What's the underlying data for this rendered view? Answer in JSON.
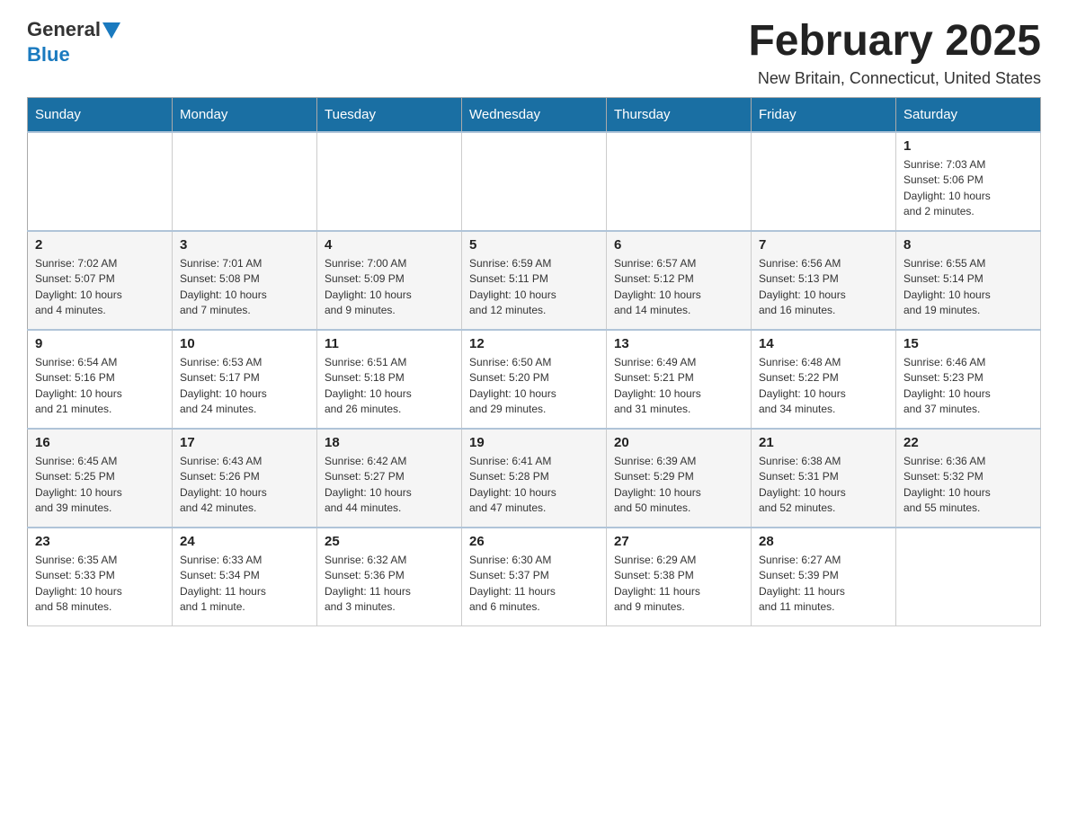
{
  "header": {
    "logo_general": "General",
    "logo_blue": "Blue",
    "title": "February 2025",
    "subtitle": "New Britain, Connecticut, United States"
  },
  "days_of_week": [
    "Sunday",
    "Monday",
    "Tuesday",
    "Wednesday",
    "Thursday",
    "Friday",
    "Saturday"
  ],
  "weeks": [
    [
      {
        "day": "",
        "info": ""
      },
      {
        "day": "",
        "info": ""
      },
      {
        "day": "",
        "info": ""
      },
      {
        "day": "",
        "info": ""
      },
      {
        "day": "",
        "info": ""
      },
      {
        "day": "",
        "info": ""
      },
      {
        "day": "1",
        "info": "Sunrise: 7:03 AM\nSunset: 5:06 PM\nDaylight: 10 hours\nand 2 minutes."
      }
    ],
    [
      {
        "day": "2",
        "info": "Sunrise: 7:02 AM\nSunset: 5:07 PM\nDaylight: 10 hours\nand 4 minutes."
      },
      {
        "day": "3",
        "info": "Sunrise: 7:01 AM\nSunset: 5:08 PM\nDaylight: 10 hours\nand 7 minutes."
      },
      {
        "day": "4",
        "info": "Sunrise: 7:00 AM\nSunset: 5:09 PM\nDaylight: 10 hours\nand 9 minutes."
      },
      {
        "day": "5",
        "info": "Sunrise: 6:59 AM\nSunset: 5:11 PM\nDaylight: 10 hours\nand 12 minutes."
      },
      {
        "day": "6",
        "info": "Sunrise: 6:57 AM\nSunset: 5:12 PM\nDaylight: 10 hours\nand 14 minutes."
      },
      {
        "day": "7",
        "info": "Sunrise: 6:56 AM\nSunset: 5:13 PM\nDaylight: 10 hours\nand 16 minutes."
      },
      {
        "day": "8",
        "info": "Sunrise: 6:55 AM\nSunset: 5:14 PM\nDaylight: 10 hours\nand 19 minutes."
      }
    ],
    [
      {
        "day": "9",
        "info": "Sunrise: 6:54 AM\nSunset: 5:16 PM\nDaylight: 10 hours\nand 21 minutes."
      },
      {
        "day": "10",
        "info": "Sunrise: 6:53 AM\nSunset: 5:17 PM\nDaylight: 10 hours\nand 24 minutes."
      },
      {
        "day": "11",
        "info": "Sunrise: 6:51 AM\nSunset: 5:18 PM\nDaylight: 10 hours\nand 26 minutes."
      },
      {
        "day": "12",
        "info": "Sunrise: 6:50 AM\nSunset: 5:20 PM\nDaylight: 10 hours\nand 29 minutes."
      },
      {
        "day": "13",
        "info": "Sunrise: 6:49 AM\nSunset: 5:21 PM\nDaylight: 10 hours\nand 31 minutes."
      },
      {
        "day": "14",
        "info": "Sunrise: 6:48 AM\nSunset: 5:22 PM\nDaylight: 10 hours\nand 34 minutes."
      },
      {
        "day": "15",
        "info": "Sunrise: 6:46 AM\nSunset: 5:23 PM\nDaylight: 10 hours\nand 37 minutes."
      }
    ],
    [
      {
        "day": "16",
        "info": "Sunrise: 6:45 AM\nSunset: 5:25 PM\nDaylight: 10 hours\nand 39 minutes."
      },
      {
        "day": "17",
        "info": "Sunrise: 6:43 AM\nSunset: 5:26 PM\nDaylight: 10 hours\nand 42 minutes."
      },
      {
        "day": "18",
        "info": "Sunrise: 6:42 AM\nSunset: 5:27 PM\nDaylight: 10 hours\nand 44 minutes."
      },
      {
        "day": "19",
        "info": "Sunrise: 6:41 AM\nSunset: 5:28 PM\nDaylight: 10 hours\nand 47 minutes."
      },
      {
        "day": "20",
        "info": "Sunrise: 6:39 AM\nSunset: 5:29 PM\nDaylight: 10 hours\nand 50 minutes."
      },
      {
        "day": "21",
        "info": "Sunrise: 6:38 AM\nSunset: 5:31 PM\nDaylight: 10 hours\nand 52 minutes."
      },
      {
        "day": "22",
        "info": "Sunrise: 6:36 AM\nSunset: 5:32 PM\nDaylight: 10 hours\nand 55 minutes."
      }
    ],
    [
      {
        "day": "23",
        "info": "Sunrise: 6:35 AM\nSunset: 5:33 PM\nDaylight: 10 hours\nand 58 minutes."
      },
      {
        "day": "24",
        "info": "Sunrise: 6:33 AM\nSunset: 5:34 PM\nDaylight: 11 hours\nand 1 minute."
      },
      {
        "day": "25",
        "info": "Sunrise: 6:32 AM\nSunset: 5:36 PM\nDaylight: 11 hours\nand 3 minutes."
      },
      {
        "day": "26",
        "info": "Sunrise: 6:30 AM\nSunset: 5:37 PM\nDaylight: 11 hours\nand 6 minutes."
      },
      {
        "day": "27",
        "info": "Sunrise: 6:29 AM\nSunset: 5:38 PM\nDaylight: 11 hours\nand 9 minutes."
      },
      {
        "day": "28",
        "info": "Sunrise: 6:27 AM\nSunset: 5:39 PM\nDaylight: 11 hours\nand 11 minutes."
      },
      {
        "day": "",
        "info": ""
      }
    ]
  ]
}
